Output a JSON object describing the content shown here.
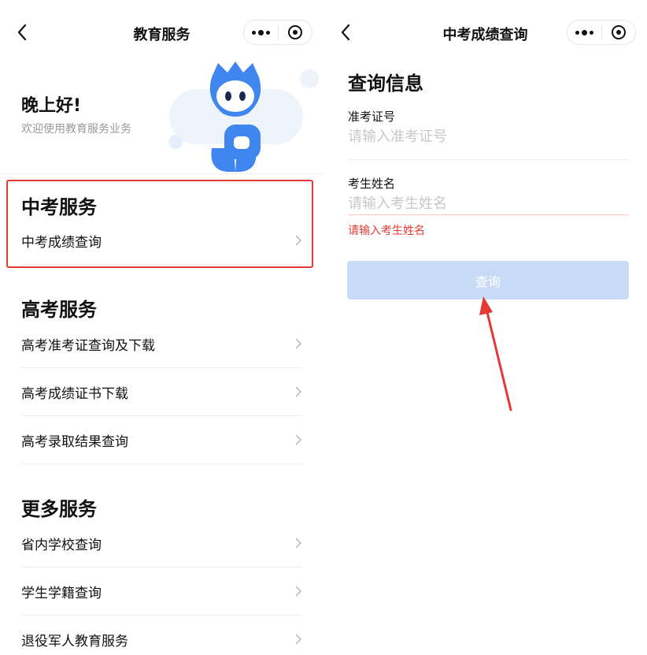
{
  "left": {
    "navbar": {
      "title": "教育服务"
    },
    "greeting": {
      "title": "晚上好!",
      "subtitle": "欢迎使用教育服务业务"
    },
    "sections": [
      {
        "title": "中考服务",
        "items": [
          "中考成绩查询"
        ]
      },
      {
        "title": "高考服务",
        "items": [
          "高考准考证查询及下载",
          "高考成绩证书下载",
          "高考录取结果查询"
        ]
      },
      {
        "title": "更多服务",
        "items": [
          "省内学校查询",
          "学生学籍查询",
          "退役军人教育服务"
        ]
      }
    ]
  },
  "right": {
    "navbar": {
      "title": "中考成绩查询"
    },
    "form": {
      "heading": "查询信息",
      "fields": [
        {
          "label": "准考证号",
          "value": "",
          "placeholder": "请输入准考证号"
        },
        {
          "label": "考生姓名",
          "value": "",
          "placeholder": "请输入考生姓名",
          "error": "请输入考生姓名"
        }
      ],
      "submit_label": "查询"
    }
  },
  "colors": {
    "highlight": "#e53935",
    "error_text": "#e53935",
    "button_disabled": "#c9dcf7",
    "mascot_blue": "#3f86ee"
  },
  "icons": {
    "back": "chevron-left-icon",
    "more": "more-dots-icon",
    "close": "target-circle-icon",
    "list_arrow": "chevron-right-icon"
  }
}
